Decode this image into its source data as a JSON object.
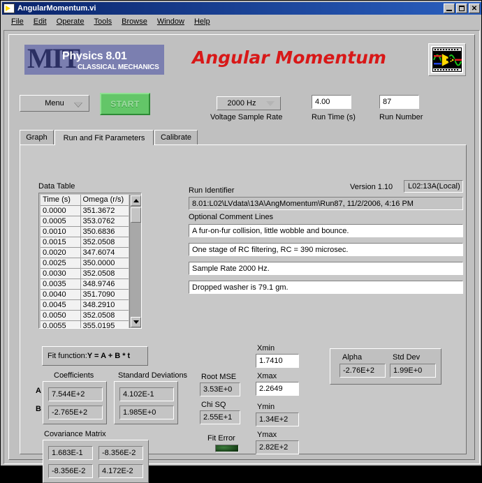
{
  "window": {
    "title": "AngularMomentum.vi",
    "icon": "labview-vi-icon",
    "buttons": {
      "minimize": "_",
      "maximize": "□",
      "close": "✕"
    }
  },
  "menubar": {
    "items": [
      "File",
      "Edit",
      "Operate",
      "Tools",
      "Browse",
      "Window",
      "Help"
    ]
  },
  "banner": {
    "logo_letters": "MIT",
    "logo_line1": "Physics 8.01",
    "logo_line2": "CLASSICAL MECHANICS",
    "logo_bg_color": "#7b7fb0",
    "logo_text_color": "#2b2f63",
    "title": "Angular Momentum",
    "title_color": "#d81818",
    "right_icon": "labview-logo-icon"
  },
  "controls": {
    "menu_button": "Menu",
    "start_button": "START",
    "voltage_sample_rate": {
      "value": "2000 Hz",
      "label": "Voltage Sample Rate"
    },
    "run_time": {
      "value": "4.00",
      "label": "Run Time (s)"
    },
    "run_number": {
      "value": "87",
      "label": "Run Number"
    }
  },
  "tabs": [
    {
      "label": "Graph",
      "active": false
    },
    {
      "label": "Run and Fit Parameters",
      "active": true
    },
    {
      "label": "Calibrate",
      "active": false
    }
  ],
  "data_table": {
    "label": "Data Table",
    "columns": [
      "Time (s)",
      "Omega (r/s)"
    ],
    "rows": [
      [
        "0.0000",
        "351.3672"
      ],
      [
        "0.0005",
        "353.0762"
      ],
      [
        "0.0010",
        "350.6836"
      ],
      [
        "0.0015",
        "352.0508"
      ],
      [
        "0.0020",
        "347.6074"
      ],
      [
        "0.0025",
        "350.0000"
      ],
      [
        "0.0030",
        "352.0508"
      ],
      [
        "0.0035",
        "348.9746"
      ],
      [
        "0.0040",
        "351.7090"
      ],
      [
        "0.0045",
        "348.2910"
      ],
      [
        "0.0050",
        "352.0508"
      ],
      [
        "0.0055",
        "355.0195"
      ]
    ]
  },
  "run_info": {
    "run_identifier_label": "Run Identifier",
    "run_identifier_value": "8.01:L02\\LVdata\\13A\\AngMomentum\\Run87, 11/2/2006, 4:16 PM",
    "version_label": "Version 1.10",
    "version_value": "L02:13A(Local)",
    "comments_label": "Optional Comment Lines",
    "comments": [
      "A fur-on-fur collision, little wobble and bounce.",
      "One stage of RC filtering, RC = 390 microsec.",
      "Sample Rate 2000 Hz.",
      "Dropped washer is 79.1 gm."
    ]
  },
  "fit": {
    "function_prefix": "Fit function: ",
    "function_formula": "Y = A + B * t",
    "coefficients_label": "Coefficients",
    "std_dev_label": "Standard Deviations",
    "row_labels": [
      "A",
      "B"
    ],
    "plus_minus": "+/-",
    "coefficients": [
      "7.544E+2",
      "-2.765E+2"
    ],
    "std_deviations": [
      "4.102E-1",
      "1.985E+0"
    ],
    "covariance_label": "Covariance Matrix",
    "covariance": [
      [
        "1.683E-1",
        "-8.356E-2"
      ],
      [
        "-8.356E-2",
        "4.172E-2"
      ]
    ]
  },
  "stats": {
    "root_mse_label": "Root MSE",
    "root_mse_value": "3.53E+0",
    "chi_sq_label": "Chi SQ",
    "chi_sq_value": "2.55E+1",
    "fit_error_label": "Fit Error",
    "fit_error_state": "off",
    "fit_error_color": "#174017"
  },
  "ranges": {
    "xmin_label": "Xmin",
    "xmin_value": "1.7410",
    "xmax_label": "Xmax",
    "xmax_value": "2.2649",
    "ymin_label": "Ymin",
    "ymin_value": "1.34E+2",
    "ymax_label": "Ymax",
    "ymax_value": "2.82E+2"
  },
  "alpha": {
    "alpha_label": "Alpha",
    "alpha_value": "-2.76E+2",
    "std_dev_label": "Std Dev",
    "std_dev_value": "1.99E+0"
  }
}
